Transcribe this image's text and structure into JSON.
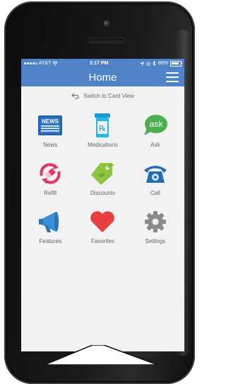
{
  "status_bar": {
    "carrier": "AT&T",
    "time": "3:17 PM",
    "battery": "88%",
    "icons": [
      "signal-dots-icon",
      "wifi-icon",
      "location-icon",
      "alarm-icon",
      "bluetooth-icon",
      "battery-icon"
    ]
  },
  "header": {
    "title": "Home",
    "menu_icon": "hamburger-menu-icon"
  },
  "switch_view": {
    "label": "Switch to Card View",
    "icon": "undo-arrow-icon"
  },
  "tiles": [
    {
      "label": "News",
      "icon": "newspaper-icon"
    },
    {
      "label": "Medications",
      "icon": "prescription-bottle-icon"
    },
    {
      "label": "Ask",
      "icon": "ask-bubble-icon"
    },
    {
      "label": "Refill",
      "icon": "refill-pill-icon"
    },
    {
      "label": "Discounts",
      "icon": "price-tag-icon"
    },
    {
      "label": "Call",
      "icon": "telephone-icon"
    },
    {
      "label": "Features",
      "icon": "megaphone-icon"
    },
    {
      "label": "Favorites",
      "icon": "heart-icon"
    },
    {
      "label": "Settings",
      "icon": "gear-icon"
    }
  ],
  "colors": {
    "header_blue": "#4f82c6",
    "news_blue": "#1f5faa",
    "med_cyan": "#29b6e8",
    "ask_green": "#4cae4c",
    "refill_pink": "#e5336b",
    "discount_green": "#8cc63f",
    "call_blue": "#1f6fb2",
    "features_blue": "#3b8fd6",
    "heart_red": "#e84040",
    "gear_gray": "#8a8a8a"
  }
}
